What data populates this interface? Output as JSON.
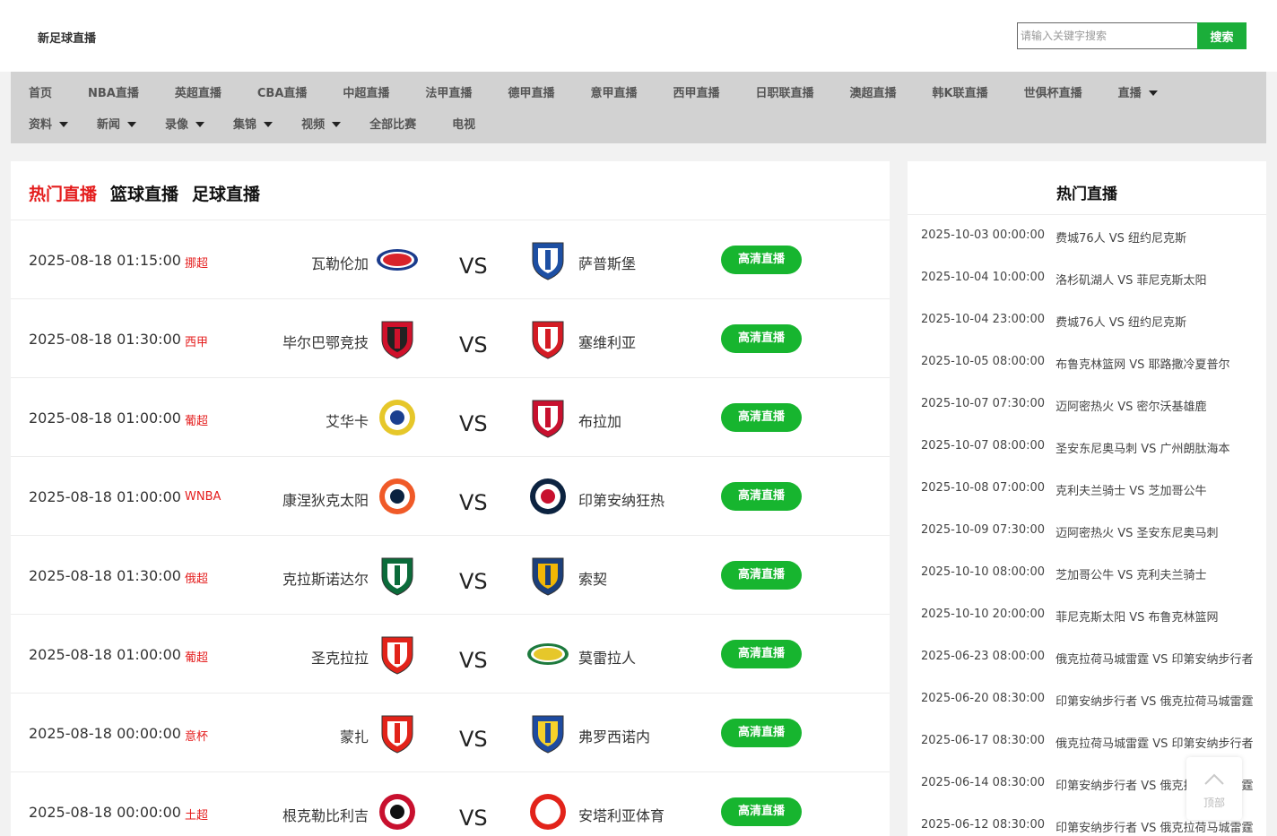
{
  "header": {
    "site_title": "新足球直播",
    "search_placeholder": "请输入关键字搜索",
    "search_button": "搜索"
  },
  "nav": {
    "row1": [
      {
        "label": "首页",
        "caret": false
      },
      {
        "label": "NBA直播",
        "caret": false
      },
      {
        "label": "英超直播",
        "caret": false
      },
      {
        "label": "CBA直播",
        "caret": false
      },
      {
        "label": "中超直播",
        "caret": false
      },
      {
        "label": "法甲直播",
        "caret": false
      },
      {
        "label": "德甲直播",
        "caret": false
      },
      {
        "label": "意甲直播",
        "caret": false
      },
      {
        "label": "西甲直播",
        "caret": false
      },
      {
        "label": "日职联直播",
        "caret": false
      },
      {
        "label": "澳超直播",
        "caret": false
      },
      {
        "label": "韩K联直播",
        "caret": false
      },
      {
        "label": "世俱杯直播",
        "caret": false
      },
      {
        "label": "直播",
        "caret": true
      }
    ],
    "row2": [
      {
        "label": "资料",
        "caret": true
      },
      {
        "label": "新闻",
        "caret": true
      },
      {
        "label": "录像",
        "caret": true
      },
      {
        "label": "集锦",
        "caret": true
      },
      {
        "label": "视频",
        "caret": true
      },
      {
        "label": "全部比赛",
        "caret": false
      },
      {
        "label": "电视",
        "caret": false
      }
    ]
  },
  "tabs": [
    "热门直播",
    "篮球直播",
    "足球直播"
  ],
  "matches": [
    {
      "time": "2025-08-18 01:15:00",
      "league": "挪超",
      "home": "瓦勒伦加",
      "away": "萨普斯堡",
      "vs": "VS",
      "button": "高清直播",
      "home_logo": "valerenga-crest-icon",
      "away_logo": "sarpsborg-crest-icon",
      "home_colors": [
        "#1a3b8c",
        "#d8232a"
      ],
      "away_colors": [
        "#1d4fa3",
        "#ffffff"
      ]
    },
    {
      "time": "2025-08-18 01:30:00",
      "league": "西甲",
      "home": "毕尔巴鄂竞技",
      "away": "塞维利亚",
      "vs": "VS",
      "button": "高清直播",
      "home_logo": "athletic-club-crest-icon",
      "away_logo": "sevilla-crest-icon",
      "home_colors": [
        "#d0112b",
        "#222222"
      ],
      "away_colors": [
        "#d41b24",
        "#ffffff"
      ]
    },
    {
      "time": "2025-08-18 01:00:00",
      "league": "葡超",
      "home": "艾华卡",
      "away": "布拉加",
      "vs": "VS",
      "button": "高清直播",
      "home_logo": "ave-crest-icon",
      "away_logo": "braga-crest-icon",
      "home_colors": [
        "#e6c72a",
        "#1b3f8f"
      ],
      "away_colors": [
        "#c8102e",
        "#ffffff"
      ]
    },
    {
      "time": "2025-08-18 01:00:00",
      "league": "WNBA",
      "home": "康涅狄克太阳",
      "away": "印第安纳狂热",
      "vs": "VS",
      "button": "高清直播",
      "home_logo": "connecticut-sun-logo-icon",
      "away_logo": "indiana-fever-logo-icon",
      "home_colors": [
        "#f05a28",
        "#0a2240"
      ],
      "away_colors": [
        "#0c2340",
        "#c8102e"
      ]
    },
    {
      "time": "2025-08-18 01:30:00",
      "league": "俄超",
      "home": "克拉斯诺达尔",
      "away": "索契",
      "vs": "VS",
      "button": "高清直播",
      "home_logo": "krasnodar-crest-icon",
      "away_logo": "sochi-crest-icon",
      "home_colors": [
        "#0b6b3a",
        "#ffffff"
      ],
      "away_colors": [
        "#1c3f7a",
        "#f2b705"
      ]
    },
    {
      "time": "2025-08-18 01:00:00",
      "league": "葡超",
      "home": "圣克拉拉",
      "away": "莫雷拉人",
      "vs": "VS",
      "button": "高清直播",
      "home_logo": "santa-clara-crest-icon",
      "away_logo": "moreirense-crest-icon",
      "home_colors": [
        "#e2231a",
        "#ffffff"
      ],
      "away_colors": [
        "#1d7a3d",
        "#e6c72a"
      ]
    },
    {
      "time": "2025-08-18 00:00:00",
      "league": "意杯",
      "home": "蒙扎",
      "away": "弗罗西诺内",
      "vs": "VS",
      "button": "高清直播",
      "home_logo": "monza-crest-icon",
      "away_logo": "frosinone-crest-icon",
      "home_colors": [
        "#e2231a",
        "#ffffff"
      ],
      "away_colors": [
        "#1e4ba0",
        "#f6d22a"
      ]
    },
    {
      "time": "2025-08-18 00:00:00",
      "league": "土超",
      "home": "根克勒比利吉",
      "away": "安塔利亚体育",
      "vs": "VS",
      "button": "高清直播",
      "home_logo": "genclerbirligi-crest-icon",
      "away_logo": "antalyaspor-crest-icon",
      "home_colors": [
        "#c8102e",
        "#111111"
      ],
      "away_colors": [
        "#e2231a",
        "#ffffff"
      ]
    }
  ],
  "sidebar": {
    "title": "热门直播",
    "items": [
      {
        "time": "2025-10-03 00:00:00",
        "match": "费城76人 VS 纽约尼克斯"
      },
      {
        "time": "2025-10-04 10:00:00",
        "match": "洛杉矶湖人 VS 菲尼克斯太阳"
      },
      {
        "time": "2025-10-04 23:00:00",
        "match": "费城76人 VS 纽约尼克斯"
      },
      {
        "time": "2025-10-05 08:00:00",
        "match": "布鲁克林篮网 VS 耶路撒冷夏普尔"
      },
      {
        "time": "2025-10-07 07:30:00",
        "match": "迈阿密热火 VS 密尔沃基雄鹿"
      },
      {
        "time": "2025-10-07 08:00:00",
        "match": "圣安东尼奥马刺 VS 广州朗肽海本"
      },
      {
        "time": "2025-10-08 07:00:00",
        "match": "克利夫兰骑士 VS 芝加哥公牛"
      },
      {
        "time": "2025-10-09 07:30:00",
        "match": "迈阿密热火 VS 圣安东尼奥马刺"
      },
      {
        "time": "2025-10-10 08:00:00",
        "match": "芝加哥公牛 VS 克利夫兰骑士"
      },
      {
        "time": "2025-10-10 20:00:00",
        "match": "菲尼克斯太阳 VS 布鲁克林篮网"
      },
      {
        "time": "2025-06-23 08:00:00",
        "match": "俄克拉荷马城雷霆 VS 印第安纳步行者"
      },
      {
        "time": "2025-06-20 08:30:00",
        "match": "印第安纳步行者 VS 俄克拉荷马城雷霆"
      },
      {
        "time": "2025-06-17 08:30:00",
        "match": "俄克拉荷马城雷霆 VS 印第安纳步行者"
      },
      {
        "time": "2025-06-14 08:30:00",
        "match": "印第安纳步行者 VS 俄克拉荷马城雷霆"
      },
      {
        "time": "2025-06-12 08:30:00",
        "match": "印第安纳步行者 VS 俄克拉荷马城雷霆"
      }
    ]
  },
  "back_to_top": {
    "label": "顶部",
    "icon": "chevron-up-icon"
  },
  "colors": {
    "accent_red": "#e41d1d",
    "button_green": "#17b52f",
    "search_green": "#1bae3a",
    "nav_bg": "#d2d2d2"
  }
}
